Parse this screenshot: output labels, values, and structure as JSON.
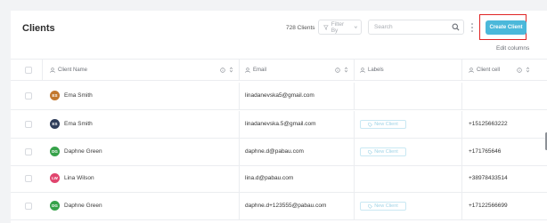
{
  "header": {
    "title": "Clients",
    "client_count": "728 Clients",
    "filter_label": "Filter By",
    "search_placeholder": "Search",
    "create_button": "Create Client",
    "edit_columns": "Edit columns"
  },
  "columns": {
    "name": "Client Name",
    "email": "Email",
    "labels": "Labels",
    "cell": "Client cell"
  },
  "colors": {
    "accent": "#4bb8da",
    "highlight": "#e02424"
  },
  "rows": [
    {
      "initials": "ES",
      "name": "Ema Smith",
      "email": "linadanevska5@gmail.com",
      "label": "",
      "phone": "",
      "avatar_color": "#c2782e"
    },
    {
      "initials": "ES",
      "name": "Ema Smith",
      "email": "linadanevska.5@gmail.com",
      "label": "New Client",
      "phone": "+15125663222",
      "avatar_color": "#2f3d5a"
    },
    {
      "initials": "DG",
      "name": "Daphne Green",
      "email": "daphne.d@pabau.com",
      "label": "New Client",
      "phone": "+171765646",
      "avatar_color": "#36a24a"
    },
    {
      "initials": "LW",
      "name": "Lina Wilson",
      "email": "lina.d@pabau.com",
      "label": "",
      "phone": "+38978433514",
      "avatar_color": "#e0456e"
    },
    {
      "initials": "DG",
      "name": "Daphne Green",
      "email": "daphne.d+123555@pabau.com",
      "label": "New Client",
      "phone": "+17122566699",
      "avatar_color": "#36a24a"
    }
  ]
}
